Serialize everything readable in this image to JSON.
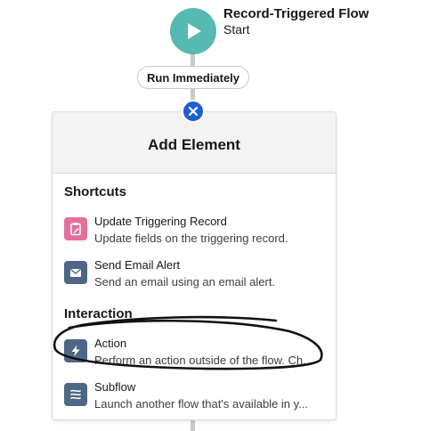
{
  "start_node": {
    "title": "Record-Triggered Flow",
    "subtitle": "Start",
    "icon": "play-icon",
    "color": "#56b9b2"
  },
  "run_pill": {
    "label": "Run Immediately"
  },
  "close_button": {
    "icon": "close-icon",
    "color": "#1b5fd1"
  },
  "panel": {
    "title": "Add Element",
    "sections": [
      {
        "title": "Shortcuts",
        "items": [
          {
            "label": "Update Triggering Record",
            "description": "Update fields on the triggering record.",
            "icon": "clipboard-edit-icon",
            "icon_color": "#e3709a"
          },
          {
            "label": "Send Email Alert",
            "description": "Send an email using an email alert.",
            "icon": "envelope-icon",
            "icon_color": "#4e6786"
          }
        ]
      },
      {
        "title": "Interaction",
        "items": [
          {
            "label": "Action",
            "description": "Perform an action outside of the flow. Ch...",
            "icon": "lightning-bolt-icon",
            "icon_color": "#4e6786"
          },
          {
            "label": "Subflow",
            "description": "Launch another flow that's available in y...",
            "icon": "subflow-icon",
            "icon_color": "#4e6786"
          }
        ]
      }
    ]
  }
}
